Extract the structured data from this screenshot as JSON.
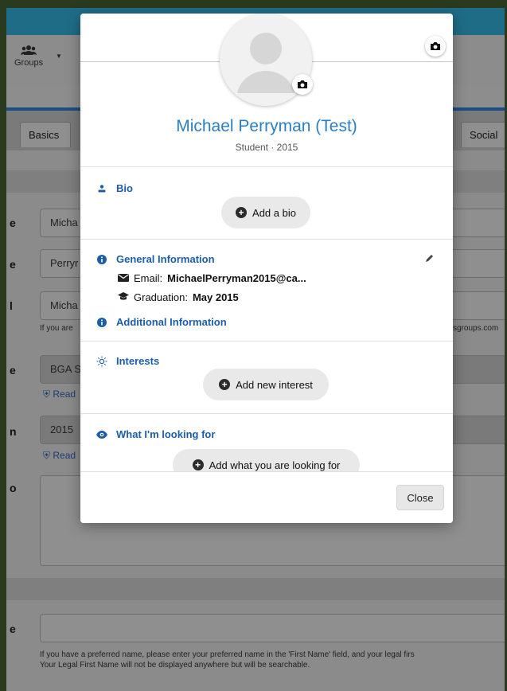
{
  "background": {
    "nav": {
      "groups_label": "Groups"
    },
    "tabs": [
      {
        "label": "Basics"
      },
      {
        "label": "Social"
      }
    ],
    "fields": {
      "first_name_value": "Micha",
      "last_name_value": "Perryr",
      "email_value": "Micha",
      "email_help_left": "If you are",
      "email_help_right": "sgroups.com",
      "chapter_value": "BGA S",
      "chapter_read_label": "Read",
      "year_value": "2015",
      "year_read_label": "Read",
      "preferred_help": "If you have a preferred name, please enter your preferred name in the 'First Name' field, and your legal firs",
      "preferred_help2": "Your Legal First Name will not be displayed anywhere but will be searchable."
    }
  },
  "modal": {
    "name": "Michael Perryman (Test)",
    "subtitle": "Student · 2015",
    "bio": {
      "title": "Bio",
      "button": "Add a bio"
    },
    "general": {
      "title": "General Information",
      "email_label": "Email:",
      "email_value": "MichaelPerryman2015@ca...",
      "graduation_label": "Graduation:",
      "graduation_value": "May 2015"
    },
    "additional": {
      "title": "Additional Information"
    },
    "interests": {
      "title": "Interests",
      "button": "Add new interest"
    },
    "looking": {
      "title": "What I'm looking for",
      "button": "Add what you are looking for"
    },
    "close_label": "Close"
  },
  "colors": {
    "accent_blue": "#1b5ea8",
    "name_blue": "#2b7fc2",
    "topbar": "#1f6c87"
  }
}
